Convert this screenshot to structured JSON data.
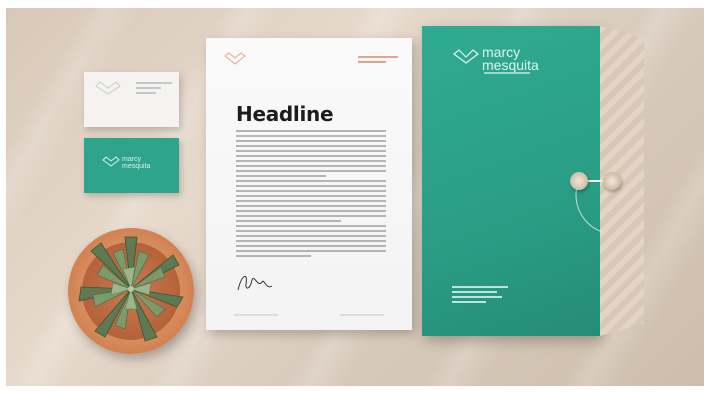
{
  "scene": {
    "description_colors": {
      "background": "#d8c8b8",
      "accent_green": "#2fa48c",
      "paper": "#f7f7f7",
      "terracotta": "#d88c5c"
    }
  },
  "letterhead": {
    "headline": "Headline"
  },
  "envelope": {
    "brand_line1": "marcy",
    "brand_line2": "mesquita"
  },
  "business_card_green": {
    "brand_line1": "marcy",
    "brand_line2": "mesquita"
  }
}
